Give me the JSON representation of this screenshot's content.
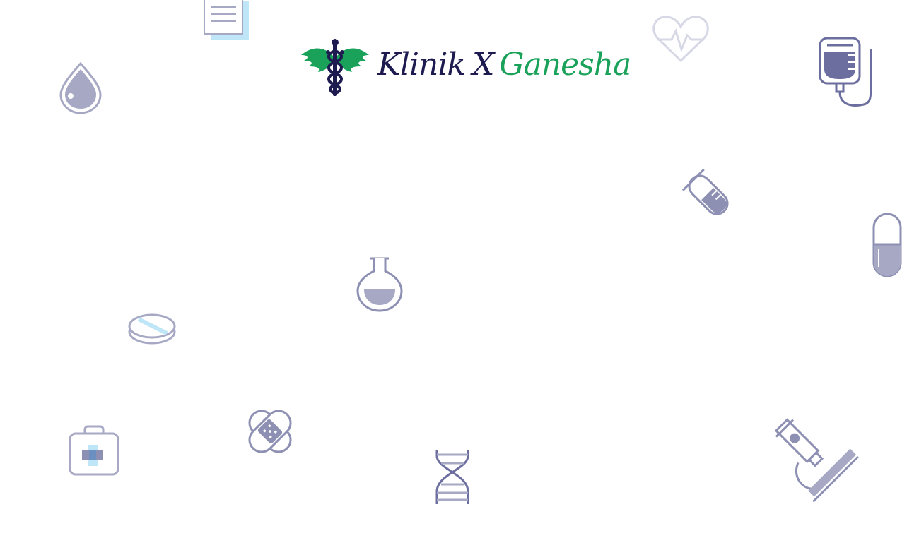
{
  "brand": {
    "word1": "Klinik",
    "word2": "X",
    "word3": "Ganesha",
    "colors": {
      "navy": "#1d1b4f",
      "green": "#1aa25a",
      "icon_stroke": "#a6a8c4",
      "icon_fill": "#8d90b3",
      "icon_dark": "#6b6e9e",
      "accent_blue": "#bfe6f6"
    }
  },
  "background_icons": [
    "clipboard-icon",
    "heartbeat-icon",
    "iv-bag-icon",
    "droplet-icon",
    "test-tube-icon",
    "capsule-icon",
    "flask-icon",
    "pill-tablet-icon",
    "first-aid-kit-icon",
    "bandage-icon",
    "dna-icon",
    "microscope-icon"
  ]
}
